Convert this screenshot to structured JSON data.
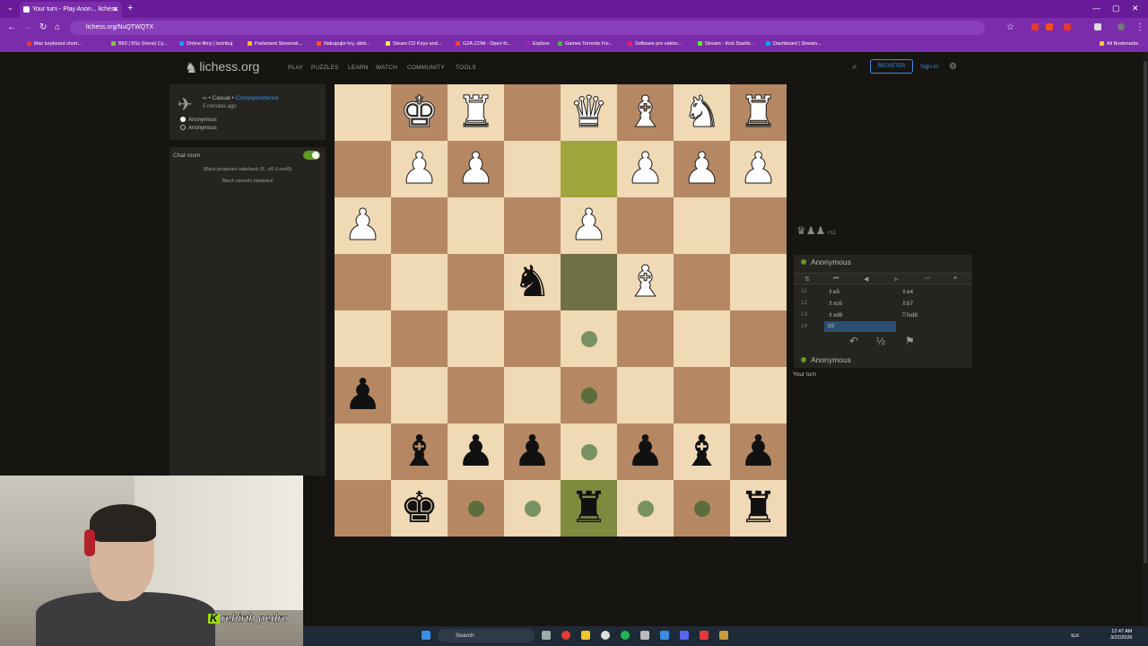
{
  "browser": {
    "tab_title": "Your turn - Play Anon... lichess",
    "url": "lichess.org/NuQTWQTX",
    "bookmarks": [
      "Mac keyboard short...",
      "B60 | BSc (Hons) Cy...",
      "Online filmy | bombuj",
      "Parlament Slovensk...",
      "Nakupujte hry, dárk...",
      "Steam CD Keys and...",
      "G2A.COM - Open th...",
      "Explore",
      "Games Torrents Fre...",
      "Software pro vektor...",
      "Stream - Kick Dashb...",
      "Dashboard | Stream...",
      "All Bookmarks"
    ]
  },
  "header": {
    "logo": "lichess.org",
    "nav": [
      "PLAY",
      "PUZZLES",
      "LEARN",
      "WATCH",
      "COMMUNITY",
      "TOOLS"
    ],
    "register": "REGISTER",
    "signin": "Sign in"
  },
  "game_info": {
    "mode_prefix": "∞ • Casual •",
    "speed": "Correspondence",
    "time_ago": "5 minutes ago",
    "players": [
      "Anonymous",
      "Anonymous"
    ]
  },
  "chat": {
    "title": "Chat room",
    "messages": [
      "Black proposes takeback (5...d5 6.exd5)",
      "Black cancels takeback"
    ]
  },
  "board": {
    "pieces": [
      {
        "r": 0,
        "c": 1,
        "g": "♚",
        "s": "w"
      },
      {
        "r": 0,
        "c": 2,
        "g": "♜",
        "s": "w"
      },
      {
        "r": 0,
        "c": 4,
        "g": "♛",
        "s": "w"
      },
      {
        "r": 0,
        "c": 5,
        "g": "♝",
        "s": "w"
      },
      {
        "r": 0,
        "c": 6,
        "g": "♞",
        "s": "w"
      },
      {
        "r": 0,
        "c": 7,
        "g": "♜",
        "s": "w"
      },
      {
        "r": 1,
        "c": 1,
        "g": "♟",
        "s": "w"
      },
      {
        "r": 1,
        "c": 2,
        "g": "♟",
        "s": "w"
      },
      {
        "r": 1,
        "c": 5,
        "g": "♟",
        "s": "w"
      },
      {
        "r": 1,
        "c": 6,
        "g": "♟",
        "s": "w"
      },
      {
        "r": 1,
        "c": 7,
        "g": "♟",
        "s": "w"
      },
      {
        "r": 2,
        "c": 0,
        "g": "♟",
        "s": "w"
      },
      {
        "r": 2,
        "c": 4,
        "g": "♟",
        "s": "w"
      },
      {
        "r": 3,
        "c": 3,
        "g": "♞",
        "s": "b"
      },
      {
        "r": 3,
        "c": 5,
        "g": "♝",
        "s": "w"
      },
      {
        "r": 5,
        "c": 0,
        "g": "♟",
        "s": "b"
      },
      {
        "r": 6,
        "c": 1,
        "g": "♝",
        "s": "b"
      },
      {
        "r": 6,
        "c": 2,
        "g": "♟",
        "s": "b"
      },
      {
        "r": 6,
        "c": 3,
        "g": "♟",
        "s": "b"
      },
      {
        "r": 6,
        "c": 5,
        "g": "♟",
        "s": "b"
      },
      {
        "r": 6,
        "c": 6,
        "g": "♝",
        "s": "b"
      },
      {
        "r": 6,
        "c": 7,
        "g": "♟",
        "s": "b"
      },
      {
        "r": 7,
        "c": 1,
        "g": "♚",
        "s": "b"
      },
      {
        "r": 7,
        "c": 4,
        "g": "♜",
        "s": "b"
      },
      {
        "r": 7,
        "c": 7,
        "g": "♜",
        "s": "b"
      }
    ],
    "move_dots": [
      {
        "r": 4,
        "c": 4
      },
      {
        "r": 5,
        "c": 4
      },
      {
        "r": 6,
        "c": 4
      },
      {
        "r": 7,
        "c": 2
      },
      {
        "r": 7,
        "c": 3
      },
      {
        "r": 7,
        "c": 5
      },
      {
        "r": 7,
        "c": 6
      }
    ],
    "highlights": [
      {
        "r": 1,
        "c": 4,
        "color": "#9ea53a"
      },
      {
        "r": 3,
        "c": 4,
        "color": "#6f7046"
      },
      {
        "r": 7,
        "c": 4,
        "color": "#7e8a3e"
      }
    ],
    "colors": {
      "light": "#f0d9b5",
      "dark": "#b58863"
    }
  },
  "material": {
    "diff": "+11"
  },
  "moves": {
    "top_player": "Anonymous",
    "bottom_player": "Anonymous",
    "rows": [
      {
        "n": "11",
        "w": "♗e5",
        "b": "♗e4"
      },
      {
        "n": "12",
        "w": "♗xc6",
        "b": "♗b7"
      },
      {
        "n": "13",
        "w": "♗xd8",
        "b": "♖fxd8"
      },
      {
        "n": "14",
        "w": "d3",
        "b": ""
      }
    ],
    "draw_label": "½",
    "status": "Your turn"
  },
  "taskbar": {
    "search": "Search",
    "lang": "SLK",
    "time": "12:47 AM",
    "date": "3/22/2026"
  },
  "stream": {
    "overlay_text": "rebirth pedro",
    "overlay_badge": "K"
  }
}
